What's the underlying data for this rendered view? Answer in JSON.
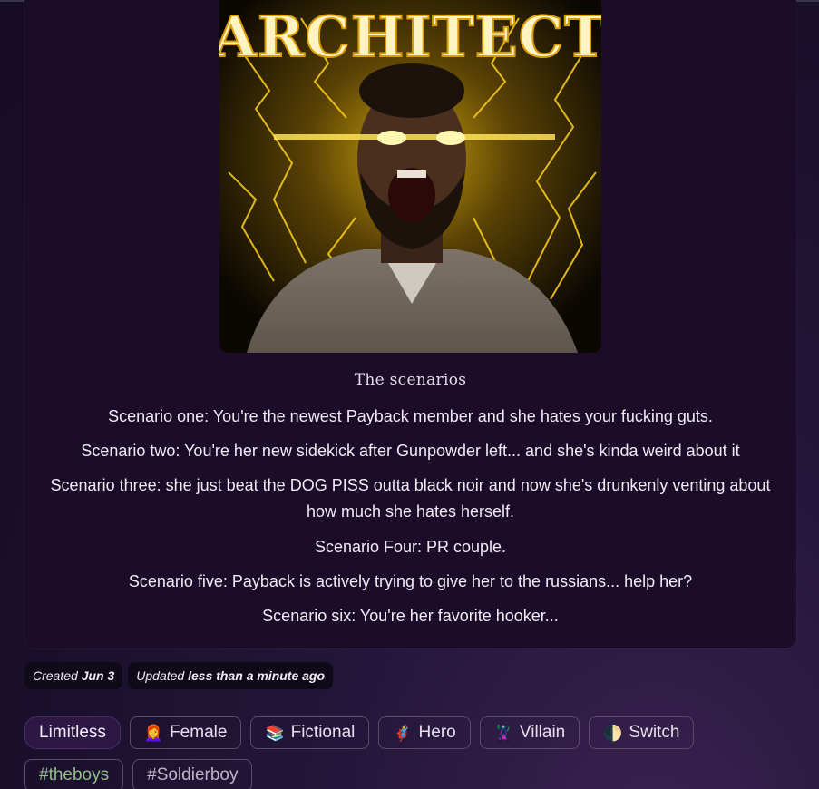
{
  "image": {
    "title_text": "ARCHITECT",
    "alt": "character portrait"
  },
  "description": {
    "title": "The scenarios",
    "scenarios": [
      "Scenario one: You're the newest Payback member and she hates your fucking guts.",
      "Scenario two: You're her new sidekick after Gunpowder left... and she's kinda weird about it",
      "Scenario three: she just beat the DOG PISS outta black noir and now she's drunkenly venting about how much she hates herself.",
      "Scenario Four: PR couple.",
      "Scenario five: Payback is actively trying to give her to the russians... help her?",
      "Scenario six: You're her favorite hooker..."
    ]
  },
  "meta": {
    "created_label": "Created",
    "created_value": "Jun 3",
    "updated_label": "Updated",
    "updated_value": "less than a minute ago"
  },
  "tags": {
    "row1": [
      {
        "label": "Limitless",
        "emoji": "",
        "active": true
      },
      {
        "label": "Female",
        "emoji": "👩‍🦰"
      },
      {
        "label": "Fictional",
        "emoji": "📚"
      },
      {
        "label": "Hero",
        "emoji": "🦸"
      },
      {
        "label": "Villain",
        "emoji": "🦹"
      },
      {
        "label": "Switch",
        "emoji": "🌓"
      }
    ],
    "row2": [
      {
        "label": "#theboys"
      },
      {
        "label": "#Soldierboy"
      }
    ]
  },
  "colors": {
    "background": "#1a0f2b",
    "card": "#1b0d2a",
    "accent": "#2c1843",
    "tag_border": "#5b4b69",
    "hashtag_green": "#8fbf8a"
  }
}
